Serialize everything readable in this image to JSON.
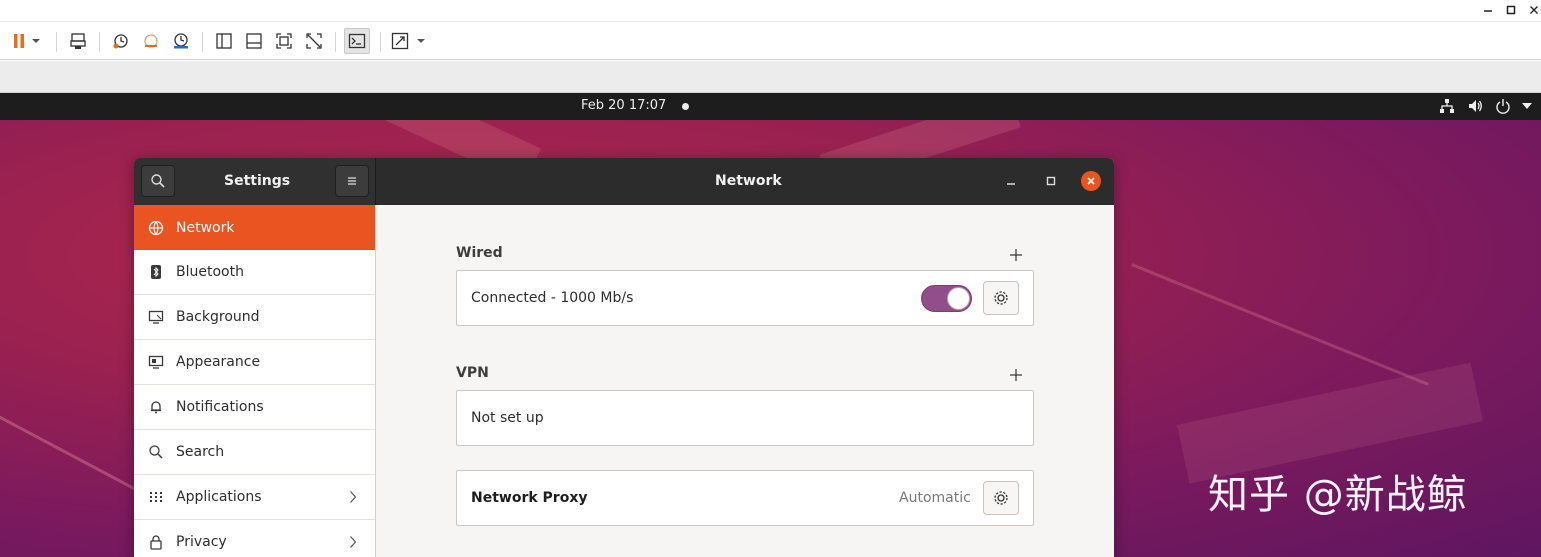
{
  "host": {
    "titlebar_controls": [
      "minimize",
      "maximize",
      "close"
    ],
    "toolbar_icons": [
      "pause-icon",
      "dropdown-icon",
      "send-ctrl-alt-del-icon",
      "snapshot-icon",
      "revert-snapshot-icon",
      "snapshot-manager-icon",
      "library-icon",
      "thumbnail-icon",
      "full-screen-icon",
      "unity-icon",
      "console-view-icon",
      "fit-guest-icon",
      "dropdown-icon"
    ],
    "accent_color": "#e96b1c"
  },
  "guest": {
    "topbar": {
      "clock": "Feb 20  17:07"
    },
    "watermark": "知乎 @新战鲸"
  },
  "settings": {
    "sidebar_title": "Settings",
    "page_title": "Network",
    "accent_color": "#e95420",
    "sidebar": {
      "items": [
        {
          "label": "Network",
          "icon": "network-icon",
          "active": true
        },
        {
          "label": "Bluetooth",
          "icon": "bluetooth-icon"
        },
        {
          "label": "Background",
          "icon": "background-icon"
        },
        {
          "label": "Appearance",
          "icon": "appearance-icon"
        },
        {
          "label": "Notifications",
          "icon": "bell-icon"
        },
        {
          "label": "Search",
          "icon": "search-icon"
        },
        {
          "label": "Applications",
          "icon": "apps-grid-icon",
          "has_chevron": true
        },
        {
          "label": "Privacy",
          "icon": "lock-icon",
          "has_chevron": true
        }
      ]
    },
    "wired": {
      "title": "Wired",
      "connection_label": "Connected - 1000 Mb/s",
      "toggle_on": true,
      "toggle_color": "#924d8b"
    },
    "vpn": {
      "title": "VPN",
      "status": "Not set up"
    },
    "proxy": {
      "label": "Network Proxy",
      "status": "Automatic"
    }
  }
}
